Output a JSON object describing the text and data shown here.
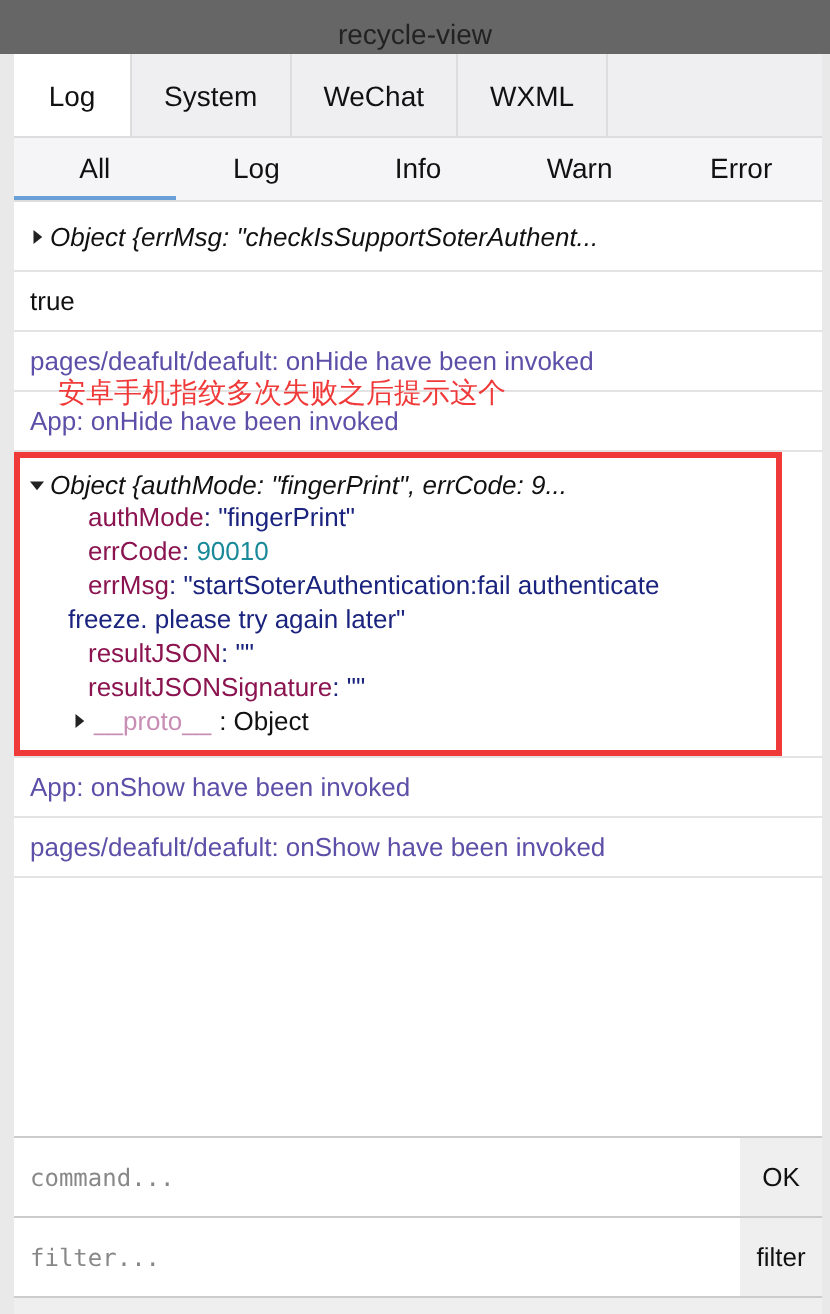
{
  "header": {
    "title": "recycle-view"
  },
  "tabs": [
    {
      "label": "Log",
      "selected": true
    },
    {
      "label": "System",
      "selected": false
    },
    {
      "label": "WeChat",
      "selected": false
    },
    {
      "label": "WXML",
      "selected": false
    }
  ],
  "filters": [
    {
      "label": "All",
      "selected": true
    },
    {
      "label": "Log",
      "selected": false
    },
    {
      "label": "Info",
      "selected": false
    },
    {
      "label": "Warn",
      "selected": false
    },
    {
      "label": "Error",
      "selected": false
    }
  ],
  "logs": [
    {
      "kind": "object",
      "expanded": false,
      "highlighted": false,
      "summary": "Object {errMsg: \"checkIsSupportSoterAuthent..."
    },
    {
      "kind": "plain",
      "text": "true"
    },
    {
      "kind": "info",
      "text": "pages/deafult/deafult: onHide have been invoked"
    },
    {
      "kind": "info",
      "text": "App: onHide have been invoked"
    },
    {
      "kind": "object",
      "expanded": true,
      "highlighted": true,
      "summary": "Object {authMode: \"fingerPrint\", errCode: 9...",
      "separator": ":",
      "properties": [
        {
          "key": "authMode",
          "value": "\"fingerPrint\"",
          "kind": "string"
        },
        {
          "key": "errCode",
          "value": "90010",
          "kind": "number"
        },
        {
          "key": "errMsg",
          "value": "\"startSoterAuthentication:fail authenticate freeze. please try again later\"",
          "kind": "string"
        },
        {
          "key": "resultJSON",
          "value": "\"\"",
          "kind": "string"
        },
        {
          "key": "resultJSONSignature",
          "value": "\"\"",
          "kind": "string"
        },
        {
          "key": "__proto__",
          "value": "Object",
          "kind": "proto",
          "expanded": false
        }
      ]
    },
    {
      "kind": "info",
      "text": "App: onShow have been invoked"
    },
    {
      "kind": "info",
      "text": "pages/deafult/deafult: onShow have been invoked"
    }
  ],
  "annotation": {
    "text": "安卓手机指纹多次失败之后提示这个"
  },
  "command": {
    "placeholder": "command...",
    "button": "OK"
  },
  "filter": {
    "placeholder": "filter...",
    "button": "filter"
  }
}
